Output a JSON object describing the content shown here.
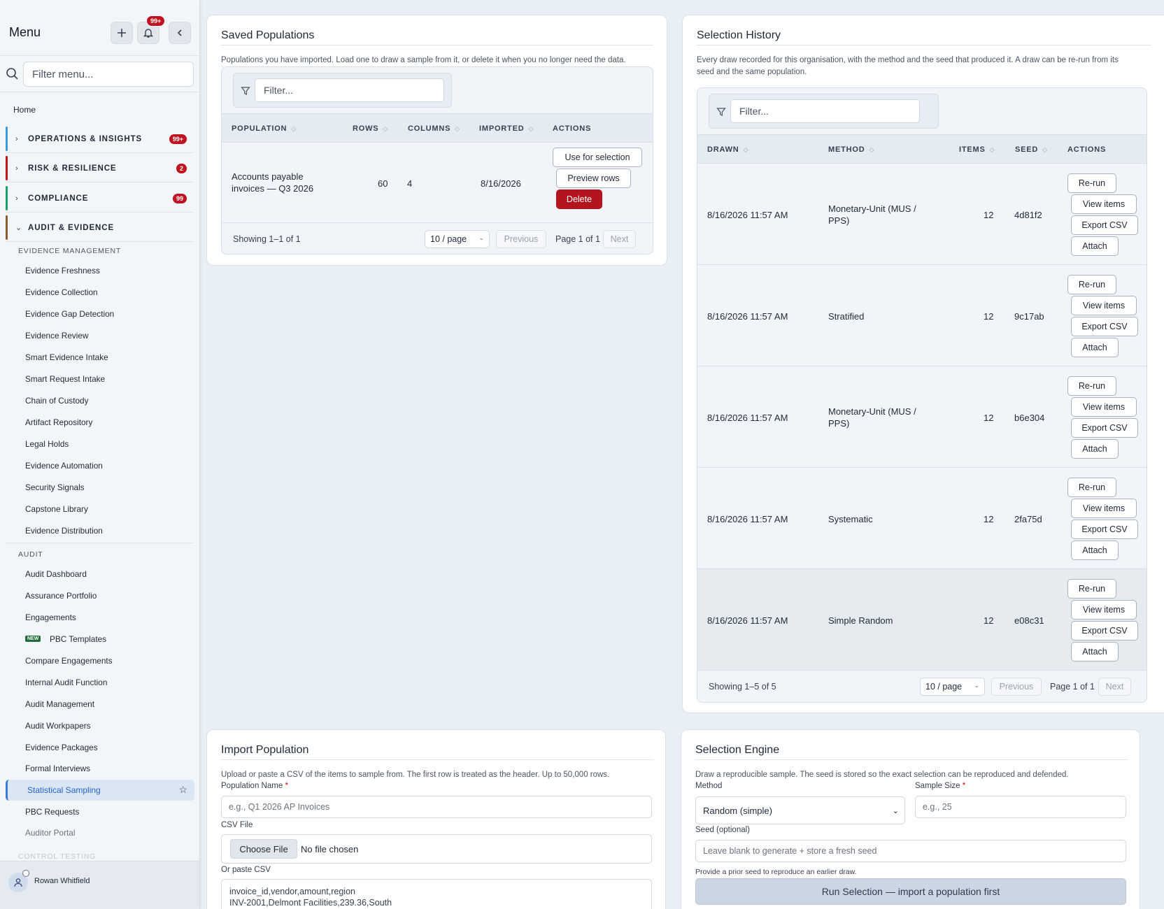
{
  "sidebar": {
    "title": "Menu",
    "notif_badge": "99+",
    "filter_placeholder": "Filter menu...",
    "home": "Home",
    "groups": [
      {
        "label": "OPERATIONS & INSIGHTS",
        "badge": "99+",
        "color": "#3b9ad9"
      },
      {
        "label": "RISK & RESILIENCE",
        "badge": "2",
        "color": "#c1121f"
      },
      {
        "label": "COMPLIANCE",
        "badge": "99",
        "color": "#1f9d6b"
      },
      {
        "label": "AUDIT & EVIDENCE",
        "badge": "",
        "color": "#8a5a2b"
      }
    ],
    "evidence_heading": "EVIDENCE MANAGEMENT",
    "evidence_items": [
      "Evidence Freshness",
      "Evidence Collection",
      "Evidence Gap Detection",
      "Evidence Review",
      "Smart Evidence Intake",
      "Smart Request Intake",
      "Chain of Custody",
      "Artifact Repository",
      "Legal Holds",
      "Evidence Automation",
      "Security Signals",
      "Capstone Library",
      "Evidence Distribution"
    ],
    "audit_heading": "AUDIT",
    "audit_items": [
      "Audit Dashboard",
      "Assurance Portfolio",
      "Engagements",
      "PBC Templates",
      "Compare Engagements",
      "Internal Audit Function",
      "Audit Management",
      "Audit Workpapers",
      "Evidence Packages",
      "Formal Interviews",
      "Statistical Sampling",
      "PBC Requests",
      "Auditor Portal"
    ],
    "new_badge": "NEW",
    "next_heading": "CONTROL TESTING",
    "user_name": "Rowan Whitfield"
  },
  "saved": {
    "title": "Saved Populations",
    "description": "Populations you have imported. Load one to draw a sample from it, or delete it when you no longer need the data.",
    "filter_placeholder": "Filter...",
    "columns": [
      "POPULATION",
      "ROWS",
      "COLUMNS",
      "IMPORTED",
      "ACTIONS"
    ],
    "rows": [
      {
        "population_line1": "Accounts payable",
        "population_line2": "invoices — Q3 2026",
        "rows": "60",
        "columns": "4",
        "imported": "8/16/2026"
      }
    ],
    "actions": {
      "use": "Use for selection",
      "preview": "Preview rows",
      "delete": "Delete"
    },
    "pager": {
      "showing": "Showing 1–1 of 1",
      "per_page": "10 / page",
      "previous": "Previous",
      "page": "Page 1 of 1",
      "next": "Next"
    }
  },
  "history": {
    "title": "Selection History",
    "description_line1": "Every draw recorded for this organisation, with the method and the seed that produced it. A draw can be re-run from its",
    "description_line2": "seed and the same population.",
    "filter_placeholder": "Filter...",
    "columns": [
      "DRAWN",
      "METHOD",
      "ITEMS",
      "SEED",
      "ACTIONS"
    ],
    "rows": [
      {
        "drawn": "8/16/2026 11:57 AM",
        "method_line1": "Monetary-Unit (MUS /",
        "method_line2": "PPS)",
        "items": "12",
        "seed": "4d81f2"
      },
      {
        "drawn": "8/16/2026 11:57 AM",
        "method_line1": "Stratified",
        "method_line2": "",
        "items": "12",
        "seed": "9c17ab"
      },
      {
        "drawn": "8/16/2026 11:57 AM",
        "method_line1": "Monetary-Unit (MUS /",
        "method_line2": "PPS)",
        "items": "12",
        "seed": "b6e304"
      },
      {
        "drawn": "8/16/2026 11:57 AM",
        "method_line1": "Systematic",
        "method_line2": "",
        "items": "12",
        "seed": "2fa75d"
      },
      {
        "drawn": "8/16/2026 11:57 AM",
        "method_line1": "Simple Random",
        "method_line2": "",
        "items": "12",
        "seed": "e08c31"
      }
    ],
    "actions": {
      "rerun": "Re-run",
      "view": "View items",
      "export": "Export CSV",
      "attach": "Attach"
    },
    "pager": {
      "showing": "Showing 1–5 of 5",
      "per_page": "10 / page",
      "previous": "Previous",
      "page": "Page 1 of 1",
      "next": "Next"
    }
  },
  "import": {
    "title": "Import Population",
    "description": "Upload or paste a CSV of the items to sample from. The first row is treated as the header. Up to 50,000 rows.",
    "name_label": "Population Name",
    "name_placeholder": "e.g., Q1 2026 AP Invoices",
    "file_label": "CSV File",
    "choose_file": "Choose File",
    "no_file": "No file chosen",
    "paste_label": "Or paste CSV",
    "paste_line1": "invoice_id,vendor,amount,region",
    "paste_line2": "INV-2001,Delmont Facilities,239.36,South"
  },
  "engine": {
    "title": "Selection Engine",
    "description": "Draw a reproducible sample. The seed is stored so the exact selection can be reproduced and defended.",
    "method_label": "Method",
    "method_value": "Random (simple)",
    "size_label": "Sample Size",
    "size_placeholder": "e.g., 25",
    "seed_label": "Seed (optional)",
    "seed_placeholder": "Leave blank to generate + store a fresh seed",
    "seed_help": "Provide a prior seed to reproduce an earlier draw.",
    "run_label": "Run Selection — import a population first"
  }
}
